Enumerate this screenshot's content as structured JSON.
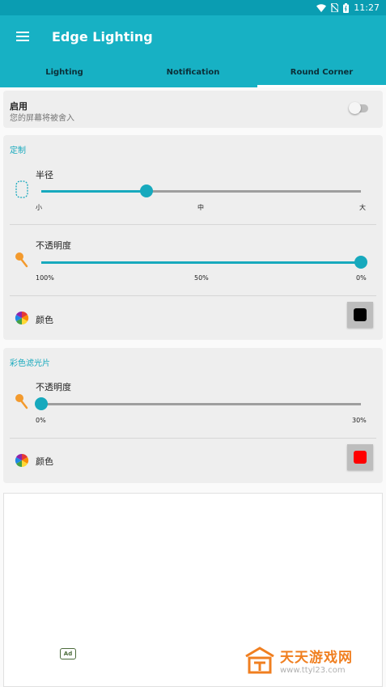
{
  "status_bar": {
    "time": "11:27",
    "icons": [
      "wifi-icon",
      "no-sim-icon",
      "battery-icon"
    ]
  },
  "app_bar": {
    "title": "Edge Lighting",
    "menu_icon": "menu-icon"
  },
  "tabs": [
    {
      "label": "Lighting",
      "active": false
    },
    {
      "label": "Notification",
      "active": false
    },
    {
      "label": "Round Corner",
      "active": true
    }
  ],
  "enable": {
    "title": "启用",
    "subtitle": "您的屏幕将被舍入",
    "on": false
  },
  "custom": {
    "title": "定制",
    "radius": {
      "label": "半径",
      "ticks": [
        "小",
        "中",
        "大"
      ],
      "value_fraction": 0.33
    },
    "opacity": {
      "label": "不透明度",
      "ticks": [
        "100%",
        "50%",
        "0%"
      ],
      "value_fraction": 1.0
    },
    "color": {
      "label": "颜色",
      "swatch": "#000000"
    }
  },
  "filter": {
    "title": "彩色滤光片",
    "opacity": {
      "label": "不透明度",
      "ticks": [
        "0%",
        "30%"
      ],
      "value_fraction": 0.0
    },
    "color": {
      "label": "颜色",
      "swatch": "#ff0000"
    }
  },
  "ad": {
    "badge": "Ad"
  },
  "watermark": {
    "name": "天天游戏网",
    "url": "www.ttyl23.com"
  },
  "colors": {
    "accent": "#17b1c4",
    "status_bar": "#0a9db2",
    "slider": "#17a9bd"
  }
}
